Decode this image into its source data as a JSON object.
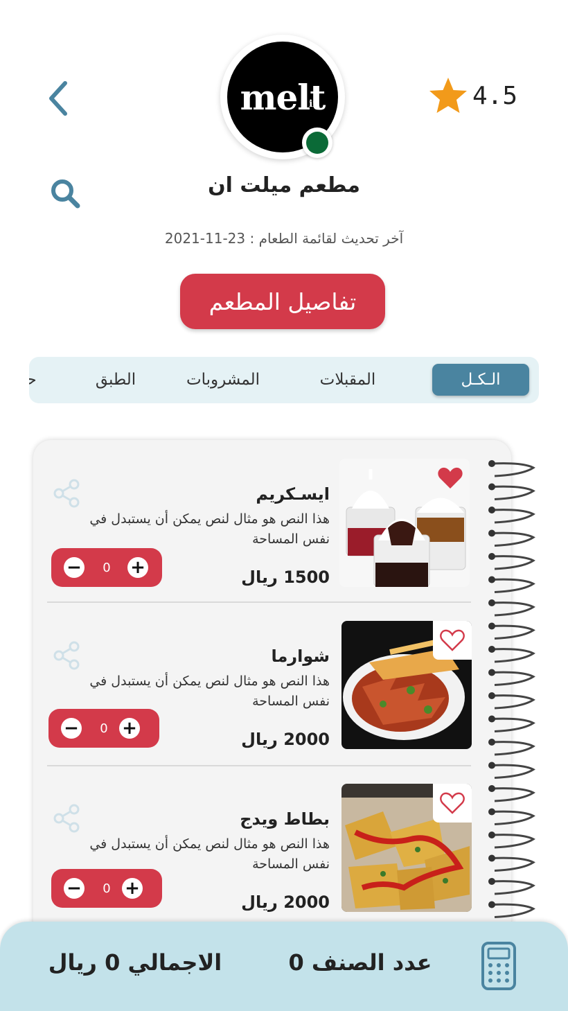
{
  "header": {
    "restaurant_name": "مطعم ميلت ان",
    "rating": "4.5",
    "last_updated": "آخر تحديث لقائمة الطعام : 23-11-2021",
    "logo_text": "melt",
    "logo_sub": "in",
    "online_status_color": "#0b6a37",
    "icons": {
      "back": "chevron-left-icon",
      "search": "search-icon",
      "rating": "star-icon"
    }
  },
  "details_button": {
    "label": "تفاصيل المطعم"
  },
  "tabs": [
    {
      "label": "الـكـل",
      "active": true
    },
    {
      "label": "المقبلات",
      "active": false
    },
    {
      "label": "المشروبات",
      "active": false
    },
    {
      "label": "الطبق",
      "active": false
    },
    {
      "label": "حلويات",
      "active": false
    }
  ],
  "items": [
    {
      "name": "ايسـكريم",
      "description": "هذا النص هو مثال لنص يمكن أن يستبدل في نفس المساحة",
      "price": "1500 ريال",
      "quantity": "0",
      "favorite": true,
      "image": "ice-cream-cups"
    },
    {
      "name": "شوارما",
      "description": "هذا النص هو مثال لنص يمكن أن يستبدل في نفس المساحة",
      "price": "2000 ريال",
      "quantity": "0",
      "favorite": false,
      "image": "shawarma-plate"
    },
    {
      "name": "بطاط ويدج",
      "description": "هذا النص هو مثال لنص يمكن أن يستبدل في نفس المساحة",
      "price": "2000 ريال",
      "quantity": "0",
      "favorite": false,
      "image": "potato-wedges"
    }
  ],
  "footer": {
    "item_count": "عدد الصنف 0",
    "total": "الاجمالي 0 ريال",
    "icon": "calculator-icon"
  },
  "colors": {
    "accent_red": "#d33a4a",
    "tab_active": "#4a84a0",
    "tab_bg": "#e5f2f5",
    "footer_bg": "#c3e2ea",
    "icon_blue": "#4a84a0",
    "star": "#f29a1a"
  }
}
